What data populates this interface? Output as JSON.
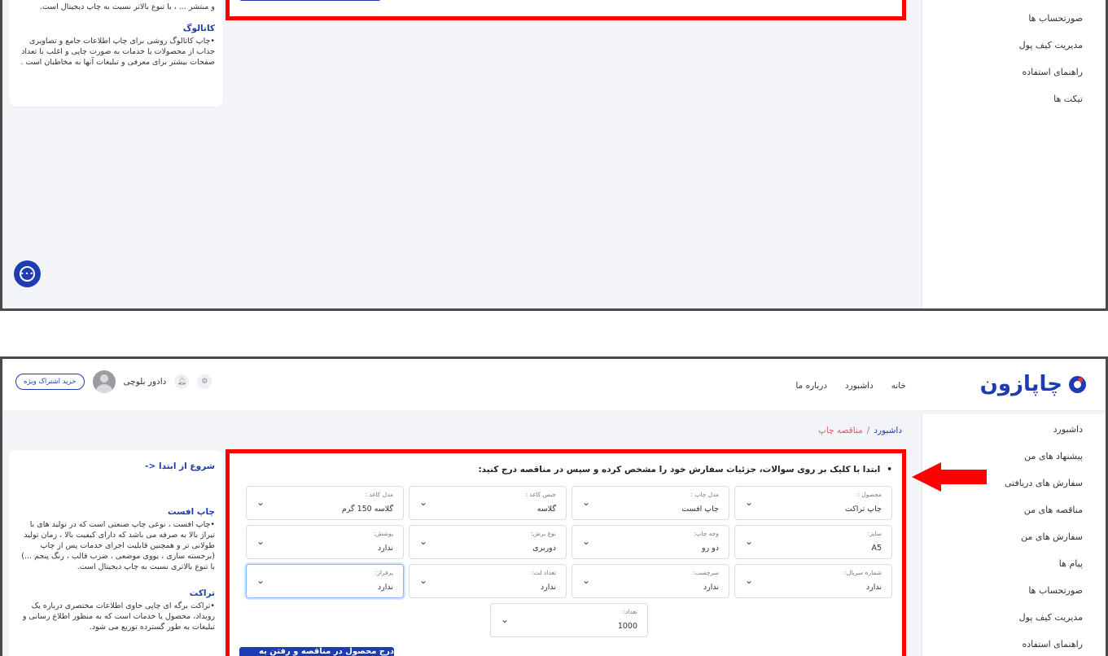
{
  "sidebar_top": [
    "صورتحساب ها",
    "مدیریت کیف پول",
    "راهنمای استفاده",
    "تیکت ها"
  ],
  "sidebar_bottom": [
    "داشبورد",
    "پیشنهاد های من",
    "سفارش های دریافتی",
    "مناقصه های من",
    "سفارش های من",
    "پیام ها",
    "صورتحساب ها",
    "مدیریت کیف پول",
    "راهنمای استفاده"
  ],
  "info_top": {
    "top_fragment": "و منتشر ... ، با تنوع بالاتر نسبت به چاپ دیجیتال است.",
    "catalog_title": "کاتالوگ",
    "catalog_body": "•چاپ کاتالوگ روشی برای چاپ اطلاعات جامع و تصاویری جذاب از محصولات یا خدمات به صورت چاپی و اغلب با تعداد صفحات بیشتر برای معرفی و تبلیغات آنها به مخاطبان است ."
  },
  "info_bottom": {
    "start_link": "شروع از ابتدا <-",
    "offset_title": "چاپ افست",
    "offset_body": "•چاپ افست ، نوعی چاپ صنعتی است که در تولید های با تیراژ بالا به صرفه می باشد که دارای کیفیت بالا ، زمان تولید طولانی تر و همچنین قابلیت اجرای خدمات پس از چاپ (برجسته سازی ، یووی موضعی ، ضرب قالب ، رنگ پنجم ...) با تنوع بالاتری نسبت به چاپ دیجیتال است.",
    "tract_title": "تراکت",
    "tract_body": "•تراکت برگه ای چاپی حاوی اطلاعات مختصری درباره یک رویداد، محصول یا خدمات است که به منظور اطلاع رسانی و تبلیغات به طور گسترده توزیع می شود."
  },
  "header": {
    "logo": "چاپازون",
    "nav": [
      "خانه",
      "داشبورد",
      "درباره ما"
    ],
    "username": "دادور بلوچی",
    "subscribe": "خرید اشتراک ویژه"
  },
  "breadcrumb": {
    "home": "داشبورد",
    "sep": "/",
    "current": "مناقصه چاپ"
  },
  "form": {
    "instruction": "ابتدا با کلیک بر روی سوالات، جزئیات سفارش خود را مشخص کرده و سپس در مناقصه درج کنید:",
    "fields": [
      {
        "label": "محصول :",
        "value": "چاپ تراکت"
      },
      {
        "label": "مدل چاپ :",
        "value": "چاپ افست"
      },
      {
        "label": "جنس کاغذ :",
        "value": "گلاسه"
      },
      {
        "label": "مدل کاغذ :",
        "value": "گلاسه 150 گرم"
      },
      {
        "label": "سایز:",
        "value": "A5"
      },
      {
        "label": "وجه چاپ:",
        "value": "دو رو"
      },
      {
        "label": "نوع برش:",
        "value": "دوربری"
      },
      {
        "label": "پوشش:",
        "value": "ندارد"
      },
      {
        "label": "شماره سریال:",
        "value": "ندارد"
      },
      {
        "label": "سرچسب:",
        "value": "ندارد"
      },
      {
        "label": "تعداد لت:",
        "value": "ندارد"
      },
      {
        "label": "پرفراژ:",
        "value": "ندارد"
      },
      {
        "label": "تعداد:",
        "value": "1000"
      }
    ],
    "submit": "درج محصول در مناقصه و رفتن به مرحله بعد"
  },
  "icons": {
    "chevron": "chevron-down-icon",
    "chat": "chat-icon",
    "bell": "bell-icon",
    "settings": "settings-icon"
  },
  "colors": {
    "primary": "#1f3bb3",
    "highlight": "#ff0000",
    "breadcrumb_current": "#e0566b"
  }
}
